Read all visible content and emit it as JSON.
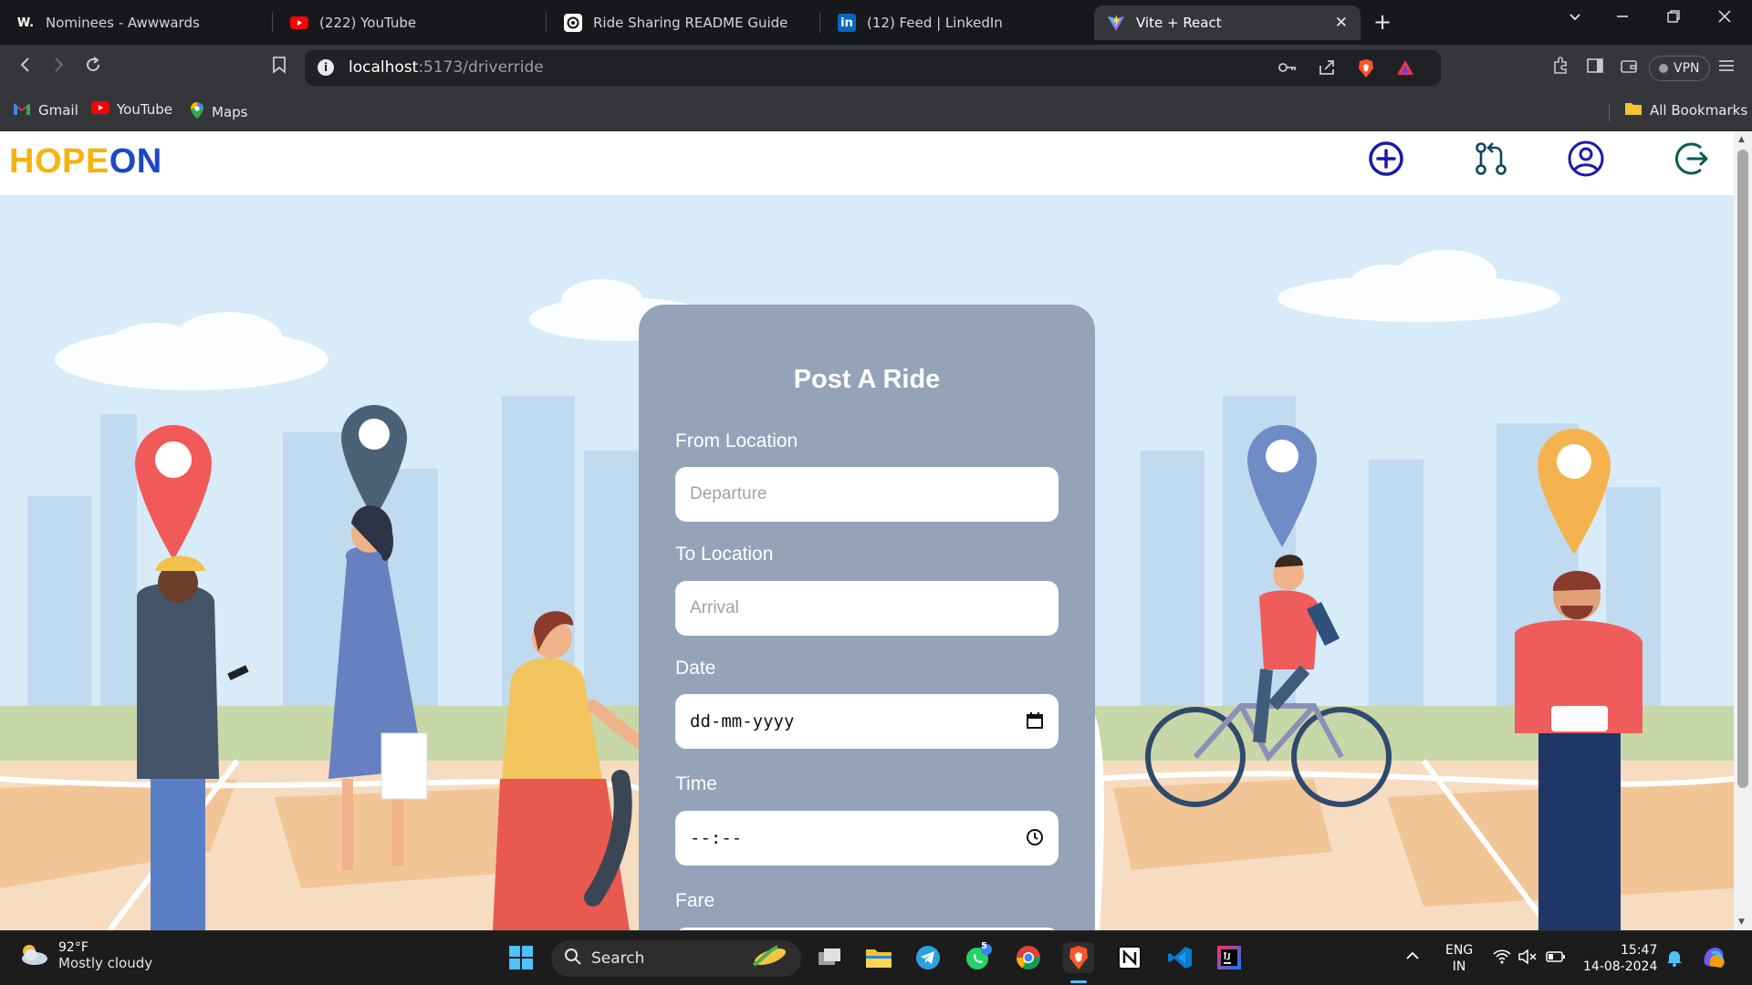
{
  "browser": {
    "tabs": [
      {
        "title": "Nominees - Awwwards",
        "icon": "awwwards-icon",
        "icon_text": "W."
      },
      {
        "title": "(222) YouTube",
        "icon": "youtube-icon"
      },
      {
        "title": "Ride Sharing README Guide",
        "icon": "chatgpt-icon"
      },
      {
        "title": "(12) Feed | LinkedIn",
        "icon": "linkedin-icon",
        "icon_text": "in"
      },
      {
        "title": "Vite + React",
        "icon": "vite-icon"
      }
    ],
    "active_tab_index": 4,
    "url_host": "localhost",
    "url_rest": ":5173/driverride",
    "vpn_label": "VPN",
    "bookmarks": [
      {
        "label": "Gmail",
        "icon": "gmail-icon"
      },
      {
        "label": "YouTube",
        "icon": "youtube-icon"
      },
      {
        "label": "Maps",
        "icon": "maps-icon"
      }
    ],
    "all_bookmarks": "All Bookmarks"
  },
  "site": {
    "logo_part1": "HOPE",
    "logo_part2": "ON",
    "nav_icons": [
      "add-circle-icon",
      "git-pull-request-icon",
      "user-circle-icon",
      "logout-icon"
    ],
    "brand_colors": {
      "yellow": "#f5b30d",
      "blue": "#1a49c9"
    }
  },
  "form": {
    "title": "Post A Ride",
    "from_label": "From Location",
    "from_placeholder": "Departure",
    "to_label": "To Location",
    "to_placeholder": "Arrival",
    "date_label": "Date",
    "date_value": "dd-mm-yyyy",
    "time_label": "Time",
    "time_value": "--:--",
    "fare_label": "Fare",
    "fare_placeholder": "₹",
    "card_color": "#94a3b8"
  },
  "taskbar": {
    "temperature": "92°F",
    "condition": "Mostly cloudy",
    "search_label": "Search",
    "whatsapp_badge": "5",
    "lang_line1": "ENG",
    "lang_line2": "IN",
    "time": "15:47",
    "date": "14-08-2024"
  }
}
